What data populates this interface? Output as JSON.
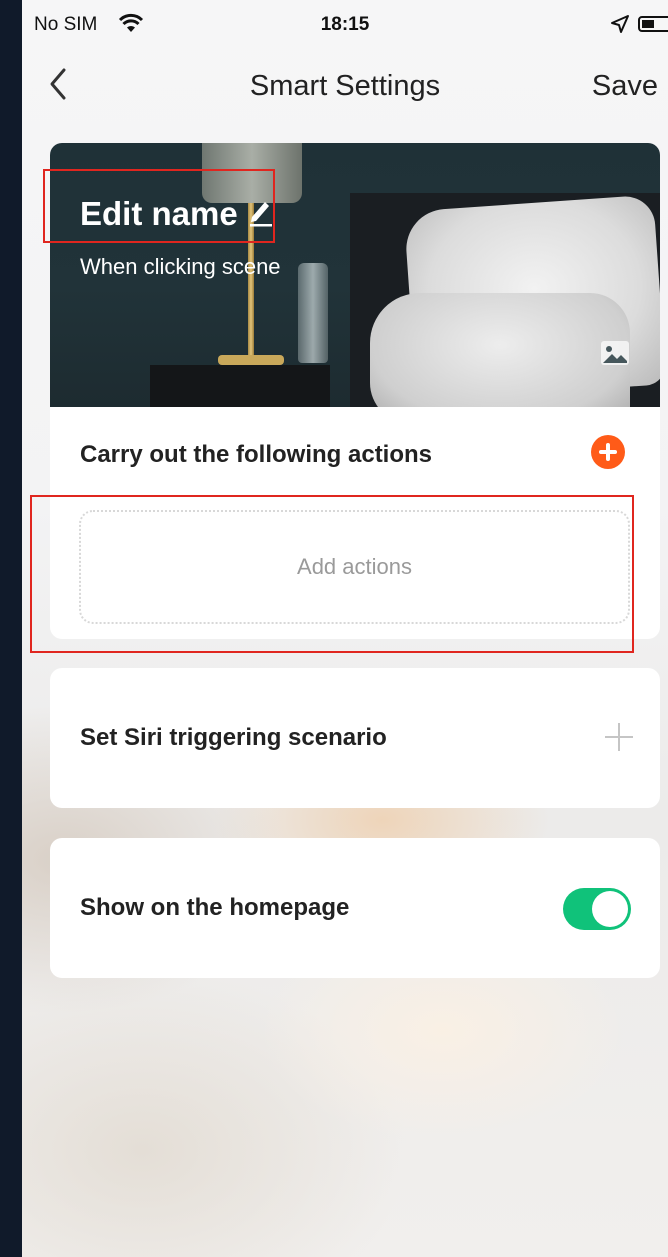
{
  "status_bar": {
    "carrier": "No SIM",
    "time": "18:15",
    "wifi_icon": "wifi-icon",
    "location_icon": "location-arrow-icon",
    "battery_icon": "battery-icon"
  },
  "nav": {
    "back_icon": "chevron-left-icon",
    "title": "Smart Settings",
    "save_label": "Save"
  },
  "scene": {
    "name": "Edit name",
    "name_edit_icon": "pencil-icon",
    "subtitle": "When clicking  scene",
    "change_image_icon": "image-icon"
  },
  "actions": {
    "heading": "Carry out the following actions",
    "add_icon": "plus-circle-icon",
    "placeholder": "Add actions"
  },
  "siri": {
    "label": "Set Siri triggering scenario",
    "add_icon": "plus-icon"
  },
  "homepage": {
    "label": "Show on the homepage",
    "enabled": true
  },
  "colors": {
    "accent_orange": "#ff5b18",
    "toggle_green": "#10c27a",
    "highlight_red": "#e0261f"
  }
}
